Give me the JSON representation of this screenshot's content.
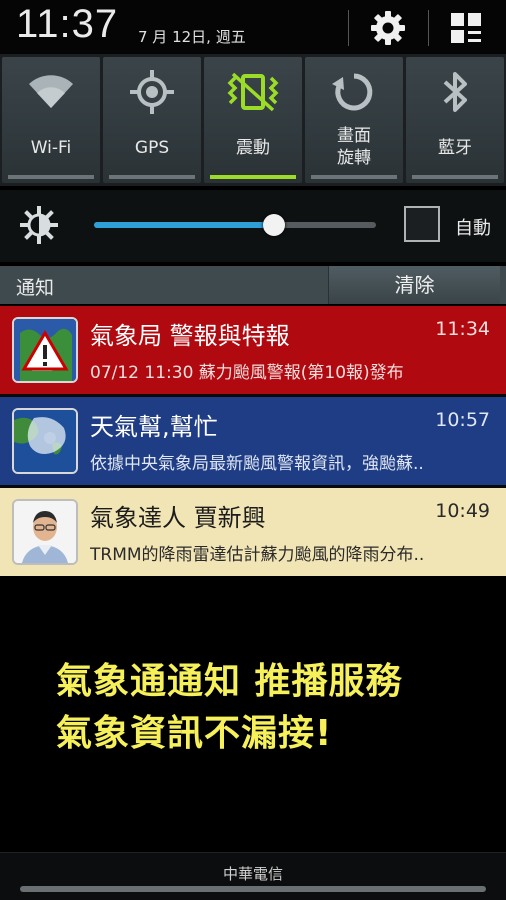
{
  "status": {
    "time": "11:37",
    "date": "7 月 12日, 週五",
    "icons": [
      "gear-icon",
      "grid-edit-icon"
    ]
  },
  "quick_settings": [
    {
      "id": "wifi",
      "label": "Wi-Fi",
      "icon": "wifi-icon",
      "active": false
    },
    {
      "id": "gps",
      "label": "GPS",
      "icon": "gps-icon",
      "active": false
    },
    {
      "id": "vibrate",
      "label": "震動",
      "icon": "vibrate-icon",
      "active": true
    },
    {
      "id": "rotate",
      "label": "畫面\n旋轉",
      "icon": "rotate-icon",
      "active": false
    },
    {
      "id": "bluetooth",
      "label": "藍牙",
      "icon": "bluetooth-icon",
      "active": false
    }
  ],
  "brightness": {
    "level": 0.64,
    "auto_label": "自動",
    "auto_checked": false
  },
  "notifications_header": {
    "title": "通知",
    "clear_label": "清除"
  },
  "notifications": [
    {
      "title": "氣象局  警報與特報",
      "time": "11:34",
      "text": "07/12 11:30 蘇力颱風警報(第10報)發布"
    },
    {
      "title": "天氣幫,幫忙",
      "time": "10:57",
      "text": "依據中央氣象局最新颱風警報資訊，強颱蘇.."
    },
    {
      "title": "氣象達人 賈新興",
      "time": "10:49",
      "text": "TRMM的降雨雷達估計蘇力颱風的降雨分布.."
    }
  ],
  "promo": {
    "line1": "氣象通通知 推播服務",
    "line2": "氣象資訊不漏接!"
  },
  "carrier": "中華電信",
  "colors": {
    "accent_active": "#9bdc28",
    "slider": "#2f9fd8",
    "promo_text": "#f6f05a"
  }
}
